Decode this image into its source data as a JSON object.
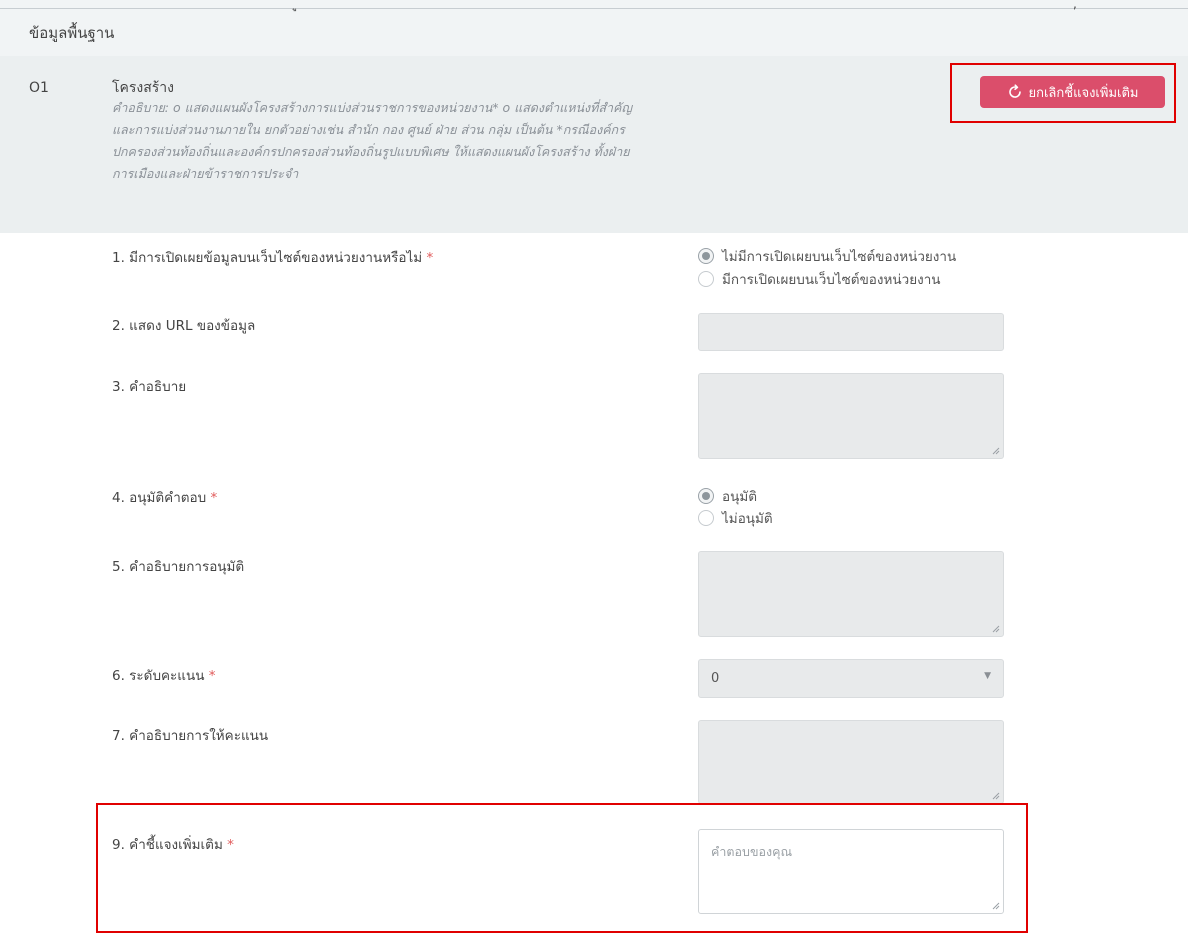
{
  "header": {
    "section_title": "ข้อมูลพื้นฐาน",
    "top_glyph_left": "ู",
    "top_glyph_right": ","
  },
  "item": {
    "code": "O1",
    "title": "โครงสร้าง",
    "description": "คำอธิบาย: o แสดงแผนผังโครงสร้างการแบ่งส่วนราชการของหน่วยงาน* o แสดงตำแหน่งที่สำคัญและการแบ่งส่วนงานภายใน ยกตัวอย่างเช่น สำนัก กอง ศูนย์ ฝ่าย ส่วน กลุ่ม เป็นต้น *กรณีองค์กรปกครองส่วนท้องถิ่นและองค์กรปกครองส่วนท้องถิ่นรูปแบบพิเศษ ให้แสดงแผนผังโครงสร้าง ทั้งฝ่ายการเมืองและฝ่ายข้าราชการประจำ",
    "cancel_button_label": "ยกเลิกชี้แจงเพิ่มเติม",
    "cancel_icon": "refresh-icon"
  },
  "questions": {
    "q1": {
      "label": "1. มีการเปิดเผยข้อมูลบนเว็บไซต์ของหน่วยงานหรือไม่",
      "required_mark": "*",
      "options": [
        "ไม่มีการเปิดเผยบนเว็บไซต์ของหน่วยงาน",
        "มีการเปิดเผยบนเว็บไซต์ของหน่วยงาน"
      ],
      "selected": "ไม่มีการเปิดเผยบนเว็บไซต์ของหน่วยงาน"
    },
    "q2": {
      "label": "2. แสดง URL ของข้อมูล",
      "value": ""
    },
    "q3": {
      "label": "3. คำอธิบาย",
      "value": ""
    },
    "q4": {
      "label": "4. อนุมัติคำตอบ",
      "required_mark": "*",
      "options": [
        "อนุมัติ",
        "ไม่อนุมัติ"
      ],
      "selected": "อนุมัติ"
    },
    "q5": {
      "label": "5. คำอธิบายการอนุมัติ",
      "value": ""
    },
    "q6": {
      "label": "6. ระดับคะแนน",
      "required_mark": "*",
      "selected_value": "0"
    },
    "q7": {
      "label": "7. คำอธิบายการให้คะแนน",
      "value": ""
    },
    "q9": {
      "label": "9. คำชี้แจงเพิ่มเติม",
      "required_mark": "*",
      "placeholder": "คำตอบของคุณ",
      "value": ""
    }
  },
  "colors": {
    "accent_button": "#db4e6b",
    "highlight_border": "#e00000",
    "required_mark": "#e05a5a"
  }
}
